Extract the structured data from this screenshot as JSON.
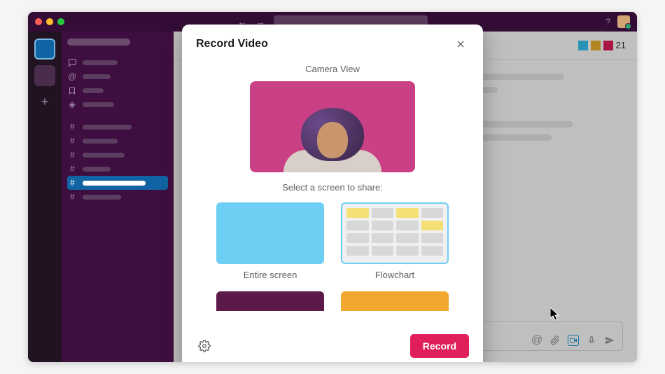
{
  "colors": {
    "accent_record": "#e01e5a",
    "camera_bg": "#c94084",
    "screen_entire": "#6ecff5",
    "flowchart_border": "#6ecff5",
    "thumb_purple": "#5c1a4a",
    "thumb_orange": "#f0a830",
    "reaction_blue": "#36c5f0",
    "reaction_yellow": "#ecb22e",
    "reaction_red": "#e01e5a"
  },
  "header": {
    "reaction_count": "21"
  },
  "modal": {
    "title": "Record Video",
    "camera_label": "Camera View",
    "select_label": "Select a screen to share:",
    "screens": {
      "entire": "Entire screen",
      "flowchart": "Flowchart"
    },
    "record_label": "Record"
  }
}
